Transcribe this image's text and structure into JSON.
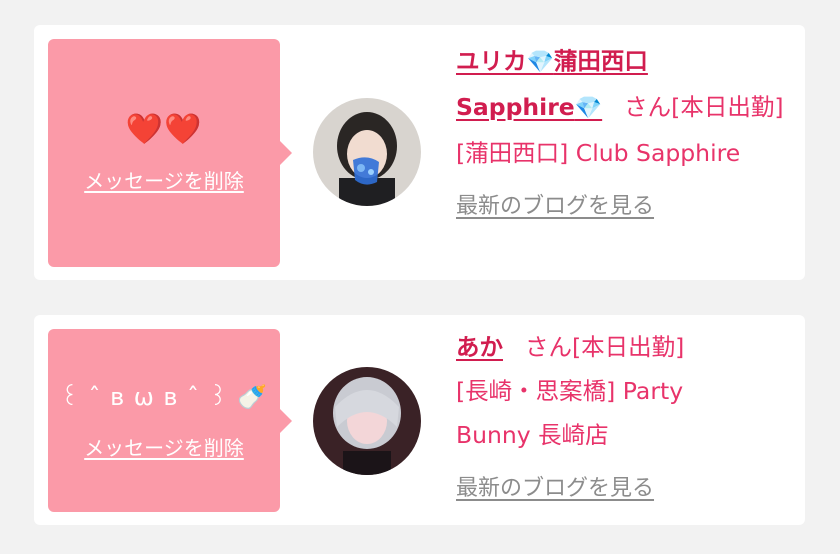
{
  "cards": [
    {
      "message_emoji": "❤️❤️",
      "delete_label": "メッセージを削除",
      "name_line1": "ユリカ",
      "name_gem1": "💎",
      "name_rest1": "蒲田西口",
      "name_line2": "Sapphire",
      "name_gem2": "💎",
      "san": "さん",
      "status": "[本日出勤]",
      "shop": "[蒲田西口] Club Sapphire",
      "blog_link": "最新のブログを見る"
    },
    {
      "message_emoji": "꒰ ˆ ʙ ω ʙ ˆ ꒱ 🍼",
      "delete_label": "メッセージを削除",
      "name": "あか",
      "san": "さん",
      "status": "[本日出勤]",
      "shop_line1": "[長崎・思案橋] Party",
      "shop_line2": "Bunny 長崎店",
      "blog_link": "最新のブログを見る"
    }
  ],
  "colors": {
    "bubble": "#fb9aa8",
    "accent": "#e8336a",
    "link_gray": "#8c8c8c"
  }
}
